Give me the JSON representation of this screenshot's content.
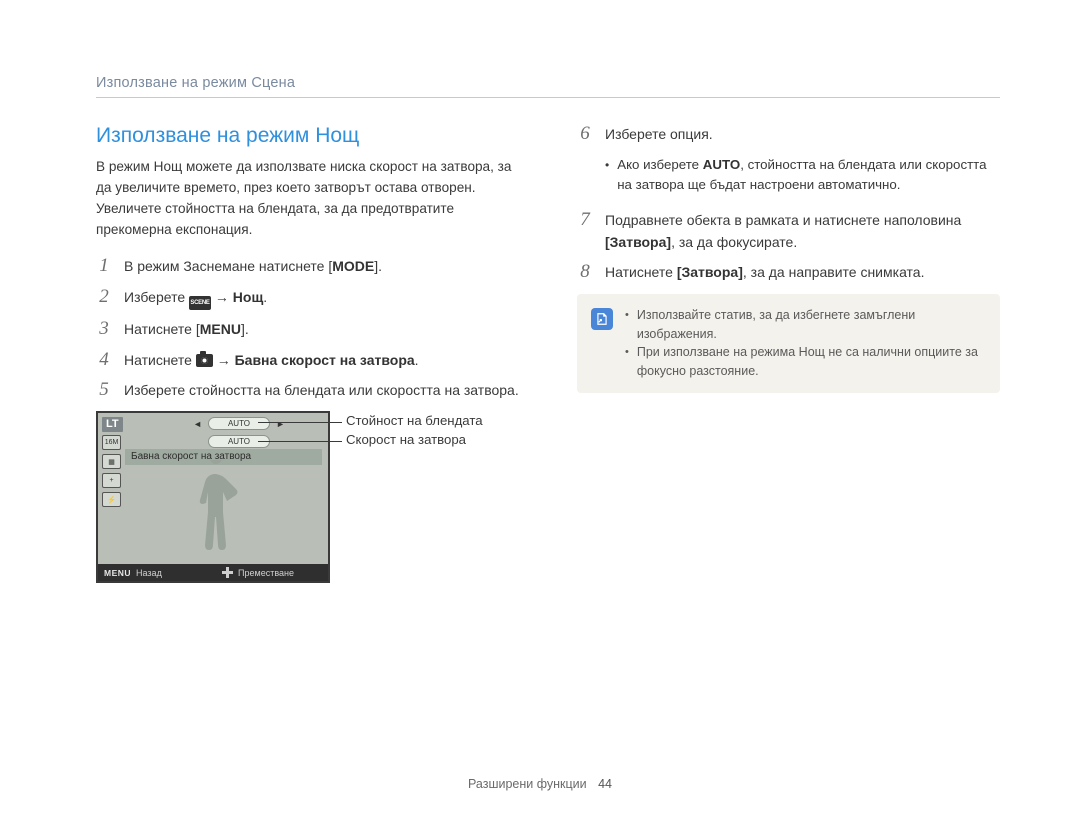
{
  "header": {
    "breadcrumb": "Използване на режим Сцена"
  },
  "left": {
    "title": "Използване на режим Нощ",
    "intro": "В режим Нощ можете да използвате ниска скорост на затвора, за да увеличите времето, през което затворът остава отворен. Увеличете стойността на блендата, за да предотвратите прекомерна експонация.",
    "steps": {
      "s1_pre": "В режим Заснемане натиснете ",
      "s1_btn": "MODE",
      "s1_post": ".",
      "s2_pre": "Изберете ",
      "s2_arrow": "→",
      "s2_target": "Нощ",
      "s2_post": ".",
      "s3_pre": "Натиснете ",
      "s3_btn": "MENU",
      "s3_post": ".",
      "s4_pre": "Натиснете ",
      "s4_arrow": "→",
      "s4_target": "Бавна скорост на затвора",
      "s4_post": ".",
      "s5": "Изберете стойността на блендата или скоростта на затвора."
    },
    "preview": {
      "lt": "LT",
      "auto1": "AUTO",
      "auto2": "AUTO",
      "bar_label": "Бавна скорост на затвора",
      "menu": "MENU",
      "back": "Назад",
      "move": "Преместване",
      "side_icon_16m": "16M"
    },
    "callouts": {
      "aperture": "Стойност на блендата",
      "shutter": "Скорост на затвора"
    }
  },
  "right": {
    "steps": {
      "s6": "Изберете опция.",
      "s6_sub_pre": "Ако изберете ",
      "s6_sub_auto": "AUTO",
      "s6_sub_post": ", стойността на блендата или скоростта на затвора ще бъдат настроени автоматично.",
      "s7_pre": "Подравнете обекта в рамката и натиснете наполовина ",
      "s7_bold1": "[Затвора]",
      "s7_mid": ", за да фокусирате.",
      "s8_pre": "Натиснете ",
      "s8_bold": "[Затвора]",
      "s8_post": ", за да направите снимката."
    },
    "tips": {
      "t1": "Използвайте статив, за да избегнете замъглени изображения.",
      "t2": "При използване на режима Нощ не са налични опциите за фокусно разстояние."
    }
  },
  "footer": {
    "section": "Разширени функции",
    "page": "44"
  }
}
